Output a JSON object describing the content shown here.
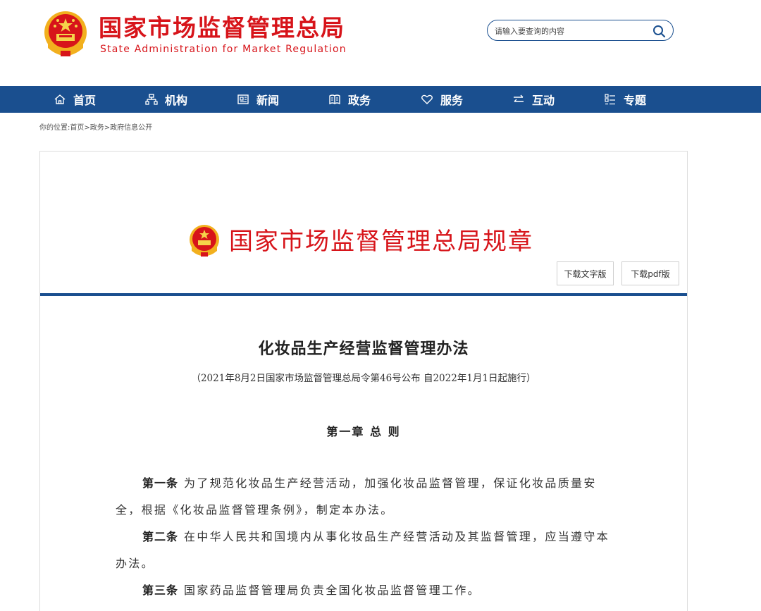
{
  "header": {
    "brand_cn": "国家市场监督管理总局",
    "brand_en": "State Administration for Market Regulation",
    "search_placeholder": "请输入要查询的内容"
  },
  "nav": {
    "items": [
      {
        "label": "首页",
        "icon": "home-icon"
      },
      {
        "label": "机构",
        "icon": "org-chart-icon"
      },
      {
        "label": "新闻",
        "icon": "news-icon"
      },
      {
        "label": "政务",
        "icon": "government-book-icon"
      },
      {
        "label": "服务",
        "icon": "heart-icon"
      },
      {
        "label": "互动",
        "icon": "exchange-arrows-icon"
      },
      {
        "label": "专题",
        "icon": "list-icon"
      }
    ]
  },
  "breadcrumb": "你的位置:首页>政务>政府信息公开",
  "regulation_header": "国家市场监督管理总局规章",
  "download": {
    "text_label": "下载文字版",
    "pdf_label": "下载pdf版"
  },
  "document": {
    "title": "化妆品生产经营监督管理办法",
    "subtitle": "（2021年8月2日国家市场监督管理总局令第46号公布 自2022年1月1日起施行）",
    "chapter": "第一章 总 则",
    "articles": [
      {
        "label": "第一条",
        "text": "为了规范化妆品生产经营活动，加强化妆品监督管理，保证化妆品质量安全，根据《化妆品监督管理条例》，制定本办法。"
      },
      {
        "label": "第二条",
        "text": "在中华人民共和国境内从事化妆品生产经营活动及其监督管理，应当遵守本办法。"
      },
      {
        "label": "第三条",
        "text": "国家药品监督管理局负责全国化妆品监督管理工作。"
      }
    ]
  },
  "colors": {
    "brand_red": "#d7141a",
    "nav_blue": "#1a4f8f"
  }
}
